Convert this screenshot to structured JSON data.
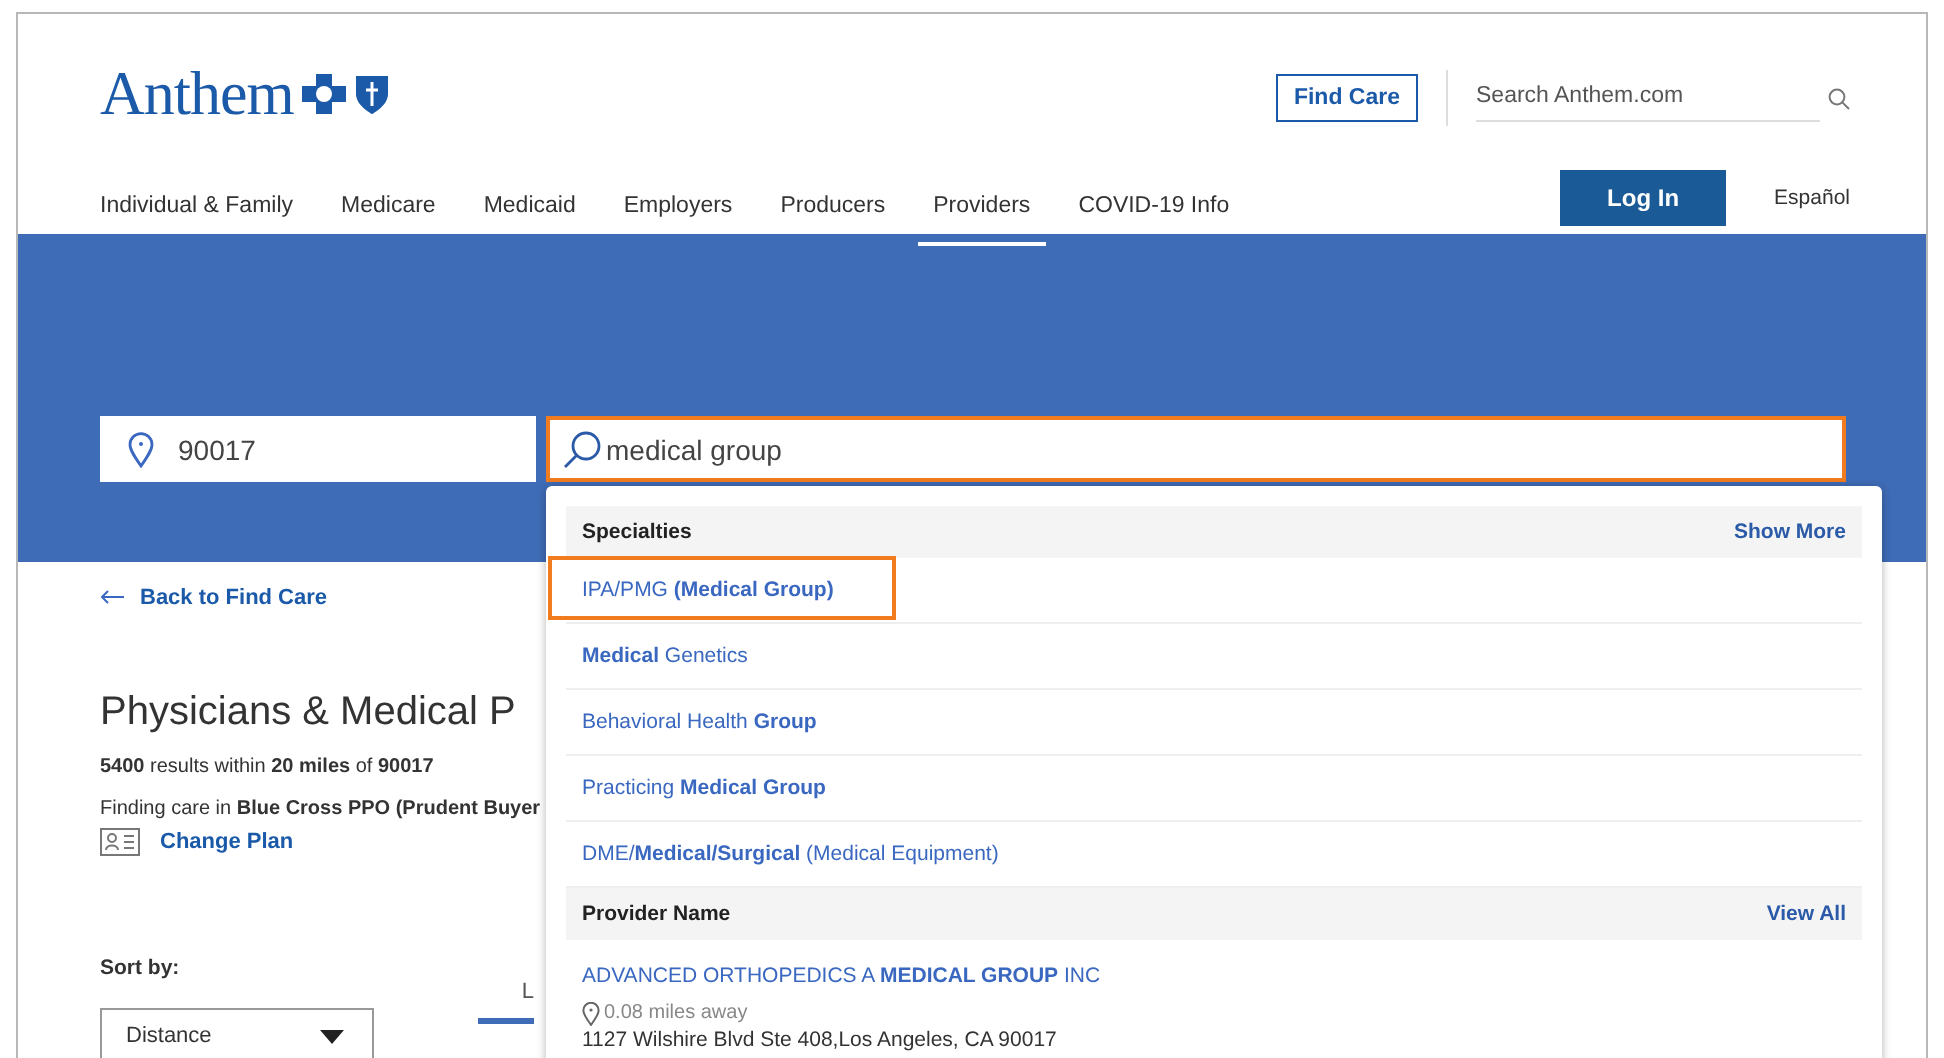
{
  "logo": {
    "text": "Anthem"
  },
  "header": {
    "find_care": "Find Care",
    "search": {
      "placeholder": "Search Anthem.com"
    },
    "login": "Log In",
    "language": "Español"
  },
  "nav": [
    {
      "label": "Individual & Family",
      "selected": false
    },
    {
      "label": "Medicare",
      "selected": false
    },
    {
      "label": "Medicaid",
      "selected": false
    },
    {
      "label": "Employers",
      "selected": false
    },
    {
      "label": "Producers",
      "selected": false
    },
    {
      "label": "Providers",
      "selected": true
    },
    {
      "label": "COVID-19 Info",
      "selected": false
    }
  ],
  "location_field": {
    "value": "90017"
  },
  "search_field": {
    "value": "medical group",
    "focused": true
  },
  "back_link": "Back to Find Care",
  "heading": "Physicians & Medical P",
  "results": "**5400** results within **20 miles** of **90017**",
  "plan_text": "Finding care in **Blue Cross PPO (Prudent Buyer**",
  "change_plan": "Change Plan",
  "sort": {
    "label": "Sort by:",
    "value": "Distance"
  },
  "tabs": [
    {
      "label": "L",
      "selected": true
    }
  ],
  "dropdown": {
    "sections": [
      {
        "title": "Specialties",
        "action": "Show More",
        "kind": "specialty",
        "items": [
          {
            "text": "IPA/PMG **(Medical Group)**",
            "selected": true
          },
          {
            "text": "**Medical** Genetics",
            "selected": false
          },
          {
            "text": "Behavioral Health **Group**",
            "selected": false
          },
          {
            "text": "Practicing **Medical Group**",
            "selected": false
          },
          {
            "text": "DME/**Medical/Surgical** (Medical Equipment)",
            "selected": false
          }
        ]
      },
      {
        "title": "Provider Name",
        "action": "View All",
        "kind": "provider",
        "items": [
          {
            "text": "ADVANCED ORTHOPEDICS A **MEDICAL GROUP** INC",
            "distance": "0.08 miles away",
            "address": "1127 Wilshire Blvd Ste 408,Los Angeles, CA 90017",
            "selected": false
          }
        ]
      }
    ]
  }
}
